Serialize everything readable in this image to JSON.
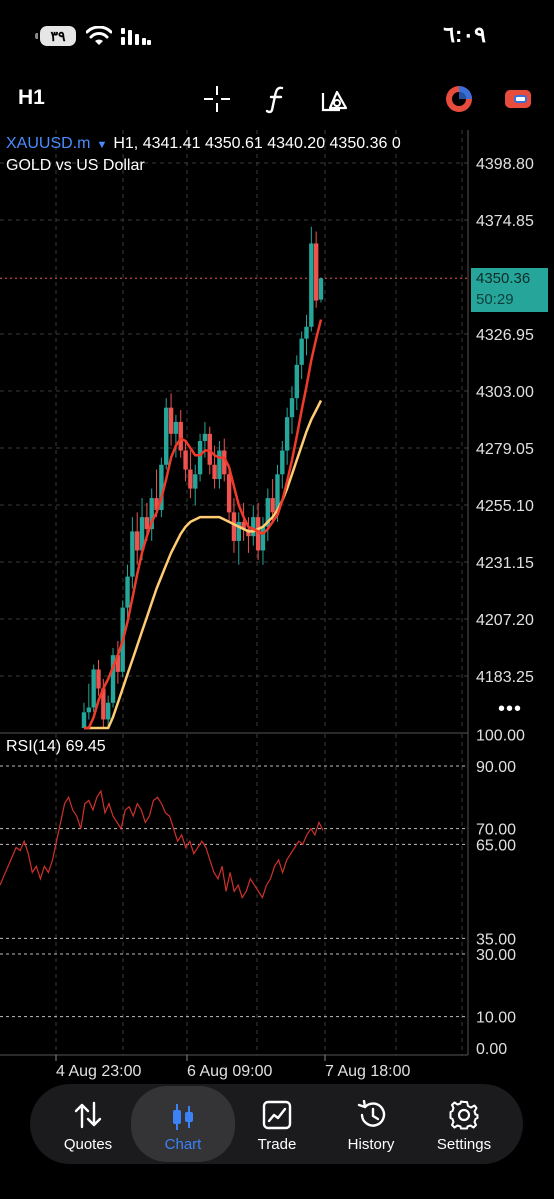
{
  "status_bar": {
    "time": "٦:٠٩",
    "battery": "٣٩",
    "icons": [
      "wifi-icon",
      "signal-icon",
      "battery-icon"
    ]
  },
  "toolbar": {
    "timeframe": "H1",
    "icons": [
      "crosshair-icon",
      "indicator-f-icon",
      "objects-icon",
      "app-logo-icon",
      "account-icon"
    ]
  },
  "chart": {
    "symbol": "XAUUSD.m",
    "header_rest": "H1, 4341.41 4350.61 4340.20 4350.36 0",
    "description": "GOLD vs US Dollar",
    "current_price": "4350.36",
    "countdown": "50:29",
    "rsi_label": "RSI(14) 69.45",
    "colors": {
      "bull": "#26a69a",
      "bear": "#ef5350",
      "ma_fast": "#ef3b2c",
      "ma_slow": "#ffcc73",
      "rsi": "#d0312d"
    }
  },
  "chart_data": [
    {
      "type": "candlestick",
      "title": "XAUUSD.m H1",
      "y_ticks": [
        4398.8,
        4374.85,
        4350.36,
        4326.95,
        4303.0,
        4279.05,
        4255.1,
        4231.15,
        4207.2,
        4183.25
      ],
      "y_tick_labels": [
        "4398.80",
        "4374.85",
        "4326.95",
        "4303.00",
        "4279.05",
        "4255.10",
        "4231.15",
        "4207.20",
        "4183.25"
      ],
      "ylim": [
        4160,
        4400
      ],
      "x_tick_labels": [
        "4 Aug 23:00",
        "6 Aug 09:00",
        "7 Aug 18:00"
      ],
      "last_price": 4350.36,
      "candles": [
        [
          4160,
          4172,
          4158,
          4168
        ],
        [
          4168,
          4180,
          4165,
          4170
        ],
        [
          4170,
          4188,
          4168,
          4186
        ],
        [
          4186,
          4190,
          4175,
          4178
        ],
        [
          4178,
          4182,
          4160,
          4165
        ],
        [
          4165,
          4175,
          4160,
          4172
        ],
        [
          4172,
          4195,
          4170,
          4192
        ],
        [
          4192,
          4198,
          4180,
          4185
        ],
        [
          4185,
          4215,
          4183,
          4212
        ],
        [
          4212,
          4230,
          4205,
          4225
        ],
        [
          4225,
          4250,
          4220,
          4244
        ],
        [
          4244,
          4252,
          4230,
          4236
        ],
        [
          4236,
          4258,
          4232,
          4250
        ],
        [
          4250,
          4256,
          4240,
          4245
        ],
        [
          4245,
          4262,
          4240,
          4258
        ],
        [
          4258,
          4270,
          4250,
          4253
        ],
        [
          4253,
          4275,
          4250,
          4272
        ],
        [
          4272,
          4300,
          4270,
          4296
        ],
        [
          4296,
          4302,
          4280,
          4285
        ],
        [
          4285,
          4293,
          4275,
          4290
        ],
        [
          4290,
          4295,
          4275,
          4278
        ],
        [
          4278,
          4282,
          4265,
          4270
        ],
        [
          4270,
          4278,
          4258,
          4262
        ],
        [
          4262,
          4272,
          4255,
          4268
        ],
        [
          4268,
          4285,
          4265,
          4282
        ],
        [
          4282,
          4290,
          4275,
          4285
        ],
        [
          4285,
          4288,
          4268,
          4272
        ],
        [
          4272,
          4280,
          4262,
          4266
        ],
        [
          4266,
          4282,
          4262,
          4278
        ],
        [
          4278,
          4283,
          4265,
          4268
        ],
        [
          4268,
          4272,
          4248,
          4252
        ],
        [
          4252,
          4258,
          4235,
          4240
        ],
        [
          4240,
          4252,
          4230,
          4248
        ],
        [
          4248,
          4256,
          4240,
          4245
        ],
        [
          4245,
          4250,
          4235,
          4242
        ],
        [
          4242,
          4255,
          4238,
          4250
        ],
        [
          4250,
          4256,
          4232,
          4236
        ],
        [
          4236,
          4250,
          4230,
          4246
        ],
        [
          4246,
          4262,
          4240,
          4258
        ],
        [
          4258,
          4266,
          4248,
          4252
        ],
        [
          4252,
          4272,
          4248,
          4268
        ],
        [
          4268,
          4282,
          4262,
          4278
        ],
        [
          4278,
          4296,
          4272,
          4292
        ],
        [
          4292,
          4305,
          4285,
          4300
        ],
        [
          4300,
          4318,
          4295,
          4314
        ],
        [
          4314,
          4328,
          4308,
          4325
        ],
        [
          4325,
          4335,
          4318,
          4330
        ],
        [
          4330,
          4372,
          4328,
          4365
        ],
        [
          4365,
          4370,
          4338,
          4341
        ],
        [
          4341.41,
          4350.61,
          4340.2,
          4350.36
        ]
      ],
      "ma_fast": [
        4150,
        4158,
        4166,
        4173,
        4178,
        4182,
        4187,
        4192,
        4198,
        4206,
        4216,
        4226,
        4235,
        4242,
        4248,
        4252,
        4258,
        4266,
        4275,
        4280,
        4283,
        4282,
        4279,
        4276,
        4276,
        4278,
        4278,
        4276,
        4275,
        4275,
        4271,
        4263,
        4255,
        4250,
        4246,
        4245,
        4244,
        4243,
        4245,
        4248,
        4251,
        4257,
        4265,
        4274,
        4284,
        4295,
        4305,
        4316,
        4325,
        4333
      ],
      "ma_slow": [
        4130,
        4136,
        4142,
        4148,
        4154,
        4160,
        4166,
        4172,
        4178,
        4184,
        4190,
        4196,
        4202,
        4208,
        4214,
        4220,
        4225,
        4230,
        4235,
        4239,
        4243,
        4246,
        4248,
        4249,
        4250,
        4250,
        4250,
        4250,
        4250,
        4249,
        4248,
        4247,
        4246,
        4245,
        4244,
        4244,
        4245,
        4246,
        4248,
        4250,
        4253,
        4257,
        4262,
        4268,
        4274,
        4280,
        4286,
        4291,
        4295,
        4299
      ]
    },
    {
      "type": "line",
      "title": "RSI(14) 69.45",
      "ylim": [
        0,
        100
      ],
      "y_ticks": [
        100,
        90,
        70,
        65,
        35,
        30,
        10,
        0
      ],
      "y_tick_labels": [
        "100.00",
        "90.00",
        "70.00",
        "65.00",
        "35.00",
        "30.00",
        "10.00",
        "0.00"
      ],
      "levels": [
        90,
        70,
        65,
        35,
        30,
        10
      ],
      "values": [
        52,
        55,
        58,
        61,
        64,
        63,
        66,
        62,
        56,
        58,
        54,
        58,
        56,
        60,
        66,
        72,
        78,
        80,
        76,
        74,
        70,
        78,
        79,
        76,
        80,
        82,
        75,
        78,
        74,
        72,
        70,
        76,
        77,
        74,
        78,
        76,
        72,
        74,
        79,
        80,
        78,
        75,
        74,
        70,
        66,
        68,
        64,
        66,
        62,
        64,
        66,
        64,
        60,
        56,
        54,
        58,
        50,
        56,
        50,
        52,
        48,
        50,
        54,
        52,
        50,
        48,
        52,
        54,
        58,
        60,
        56,
        60,
        62,
        64,
        66,
        65,
        68,
        70,
        68,
        72,
        69.45
      ]
    }
  ],
  "nav": {
    "items": [
      {
        "label": "Quotes",
        "icon": "quotes-arrows-icon"
      },
      {
        "label": "Chart",
        "icon": "candlestick-icon"
      },
      {
        "label": "Trade",
        "icon": "trade-chart-icon"
      },
      {
        "label": "History",
        "icon": "history-clock-icon"
      },
      {
        "label": "Settings",
        "icon": "gear-icon"
      }
    ],
    "active": "Chart"
  }
}
